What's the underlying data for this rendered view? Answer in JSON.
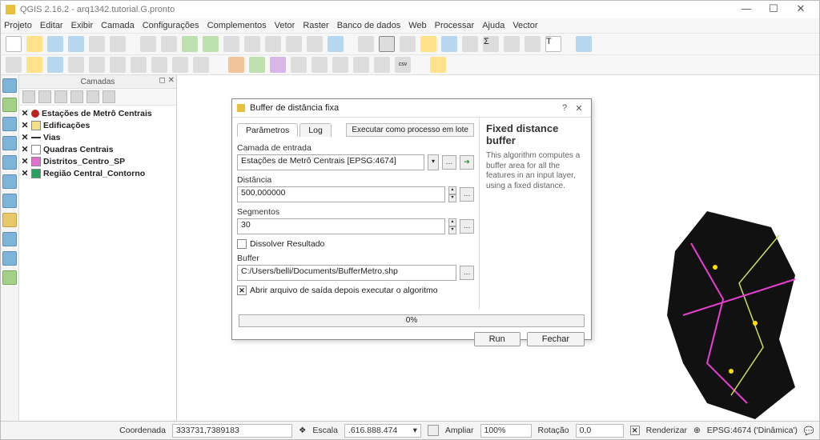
{
  "app": {
    "title": "QGIS 2.16.2 - arq1342.tutorial.G.pronto"
  },
  "menu": [
    "Projeto",
    "Editar",
    "Exibir",
    "Camada",
    "Configurações",
    "Complementos",
    "Vetor",
    "Raster",
    "Banco de dados",
    "Web",
    "Processar",
    "Ajuda",
    "Vector"
  ],
  "panel": {
    "title": "Camadas"
  },
  "layers": [
    {
      "name": "Estações de Metrô Centrais",
      "shape": "dot",
      "color": "#c02020",
      "bold": true
    },
    {
      "name": "Edificações",
      "shape": "sq",
      "color": "#f2e08a",
      "bold": true
    },
    {
      "name": "Vias",
      "shape": "line",
      "color": "#333",
      "bold": true
    },
    {
      "name": "Quadras Centrais",
      "shape": "sq",
      "color": "#fff",
      "bold": true
    },
    {
      "name": "Distritos_Centro_SP",
      "shape": "sq",
      "color": "#e270d0",
      "bold": true
    },
    {
      "name": "Região Central_Contorno",
      "shape": "sq",
      "color": "#2aa060",
      "bold": true
    }
  ],
  "dialog": {
    "title": "Buffer de distância fixa",
    "tabs": {
      "params": "Parâmetros",
      "log": "Log"
    },
    "batch": "Executar como processo em lote",
    "inputLabel": "Camada de entrada",
    "inputValue": "Estações de Metrô Centrais [EPSG:4674]",
    "distLabel": "Distância",
    "distValue": "500,000000",
    "segLabel": "Segmentos",
    "segValue": "30",
    "dissolve": "Dissolver Resultado",
    "bufferLabel": "Buffer",
    "bufferValue": "C:/Users/belli/Documents/BufferMetro.shp",
    "openAfter": "Abrir arquivo de saída depois executar o algoritmo",
    "helpTitle": "Fixed distance buffer",
    "helpText": "This algorithm computes a buffer area for all the features in an input layer, using a fixed distance.",
    "progress": "0%",
    "run": "Run",
    "close": "Fechar"
  },
  "status": {
    "coordLabel": "Coordenada",
    "coordValue": "333731,7389183",
    "scaleLabel": "Escala",
    "scaleValue": "616.888.474",
    "magLabel": "Ampliar",
    "magValue": "100%",
    "rotLabel": "Rotação",
    "rotValue": "0,0",
    "render": "Renderizar",
    "crs": "EPSG:4674 ('Dinâmica')"
  }
}
